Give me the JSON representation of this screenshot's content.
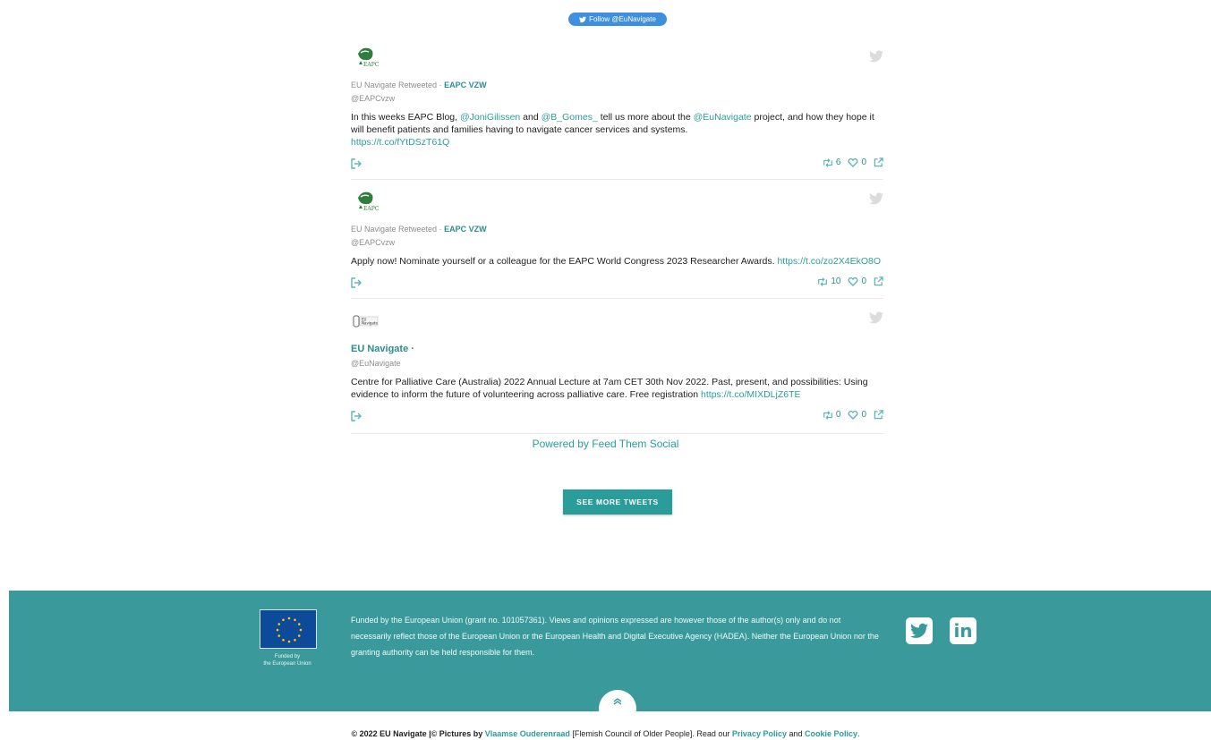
{
  "follow_button": {
    "label": "Follow @EuNavigate"
  },
  "tweets": [
    {
      "retweet_label": "EU Navigate Retweeted · ",
      "author": "EAPC VZW",
      "handle": "@EAPCvzw",
      "text_parts": [
        {
          "t": "In this weeks EAPC Blog, ",
          "link": false
        },
        {
          "t": "@JoniGilissen",
          "link": true
        },
        {
          "t": " and ",
          "link": false
        },
        {
          "t": "@B_Gomes_",
          "link": true
        },
        {
          "t": " tell us more about the ",
          "link": false
        },
        {
          "t": "@EuNavigate",
          "link": true
        },
        {
          "t": " project, and how they hope it will benefit patients and families having to navigate cancer services and systems.",
          "link": false
        },
        {
          "t": "https://t.co/fYtDSzT61Q",
          "link": true,
          "newline": true
        }
      ],
      "retweets": "6",
      "likes": "0",
      "avatar": "eapc"
    },
    {
      "retweet_label": "EU Navigate Retweeted · ",
      "author": "EAPC VZW",
      "handle": "@EAPCvzw",
      "text_parts": [
        {
          "t": "Apply now! Nominate yourself or a colleague for the EAPC World Congress 2023 Researcher Awards. ",
          "link": false
        },
        {
          "t": "https://t.co/zo2X4EkO8O",
          "link": true
        }
      ],
      "retweets": "10",
      "likes": "0",
      "avatar": "eapc"
    },
    {
      "retweet_label": "",
      "author": "EU Navigate",
      "author_suffix": " ·",
      "handle": "@EuNavigate",
      "text_parts": [
        {
          "t": "Centre for Palliative Care (Australia) 2022 Annual Lecture at 7am CET 30th Nov 2022. Past, present, and possibilities: Using evidence to inform the future of volunteering across palliative care. Free registration ",
          "link": false
        },
        {
          "t": "https://t.co/MIXDLjZ6TE",
          "link": true
        }
      ],
      "retweets": "0",
      "likes": "0",
      "avatar": "eunav"
    }
  ],
  "powered_by": "Powered by Feed Them Social",
  "see_more_label": "SEE MORE TWEETS",
  "footer": {
    "eu_caption_line1": "Funded by",
    "eu_caption_line2": "the European Union",
    "disclaimer": "Funded by the European Union (grant no. 101057361). Views and opinions expressed are however those of the author(s) only and do not necessarily reflect those of the European Union or the European Health and Digital Executive Agency (HADEA). Neither the European Union nor the granting authority can be held responsible for them.",
    "social": [
      "twitter-icon",
      "linkedin-icon"
    ],
    "linkedin_label": "in"
  },
  "copyright": {
    "prefix": "© 2022 EU Navigate |© Pictures by ",
    "pictures_link": "Vlaamse Ouderenraad",
    "middle": " [Flemish Council of Older People]. Read our ",
    "privacy_link": "Privacy Policy",
    "and": " and ",
    "cookie_link": "Cookie Policy",
    "end": "."
  },
  "colors": {
    "accent": "#2a9d9a",
    "footer_bg": "#3a9a9b",
    "follow_button": "#3f8fe0",
    "eu_flag": "#0e4a9a",
    "eu_star": "#ffcc00"
  }
}
